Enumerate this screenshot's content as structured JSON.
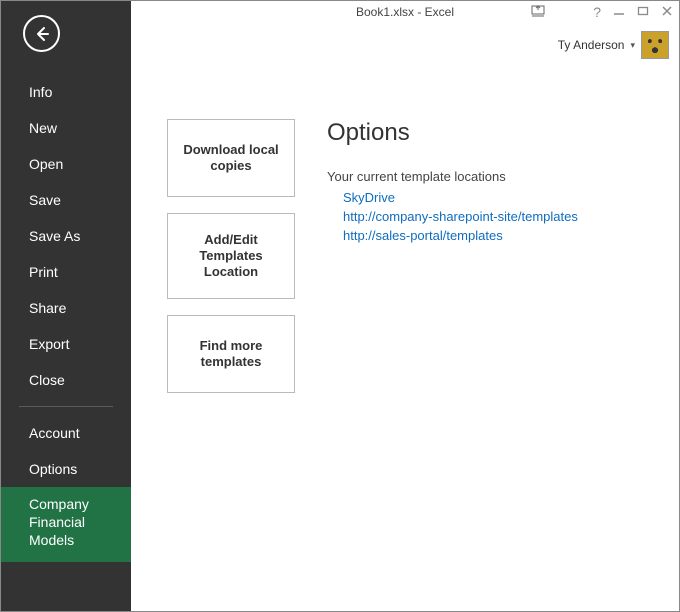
{
  "title": "Book1.xlsx - Excel",
  "user": {
    "name": "Ty Anderson"
  },
  "sidebar": {
    "items": [
      {
        "label": "Info"
      },
      {
        "label": "New"
      },
      {
        "label": "Open"
      },
      {
        "label": "Save"
      },
      {
        "label": "Save As"
      },
      {
        "label": "Print"
      },
      {
        "label": "Share"
      },
      {
        "label": "Export"
      },
      {
        "label": "Close"
      }
    ],
    "footer": [
      {
        "label": "Account"
      },
      {
        "label": "Options"
      },
      {
        "label": "Company Financial Models",
        "active": true
      }
    ]
  },
  "tiles": {
    "download": "Download local copies",
    "addedit": "Add/Edit Templates Location",
    "findmore": "Find more templates"
  },
  "options": {
    "heading": "Options",
    "subhead": "Your current template locations",
    "links": [
      "SkyDrive",
      "http://company-sharepoint-site/templates",
      "http://sales-portal/templates"
    ]
  }
}
